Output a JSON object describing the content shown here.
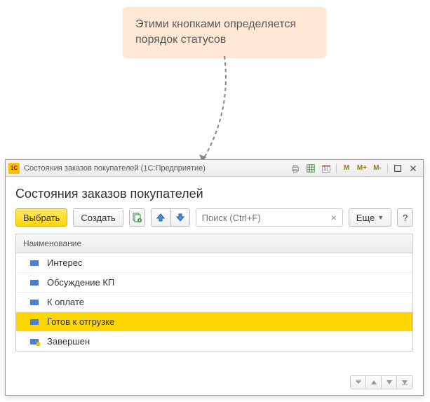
{
  "callout": {
    "text": "Этими кнопками определяется порядок статусов"
  },
  "window": {
    "title": "Состояния заказов покупателей  (1С:Предприятие)",
    "app_icon_text": "1C"
  },
  "page": {
    "title": "Состояния заказов покупателей"
  },
  "toolbar": {
    "select_label": "Выбрать",
    "create_label": "Создать",
    "search_placeholder": "Поиск (Ctrl+F)",
    "more_label": "Еще",
    "help_label": "?"
  },
  "titlebar_buttons": {
    "m": "M",
    "m_plus": "M+",
    "m_minus": "M-"
  },
  "table": {
    "header": "Наименование",
    "rows": [
      {
        "label": "Интерес",
        "final": false,
        "selected": false
      },
      {
        "label": "Обсуждение КП",
        "final": false,
        "selected": false
      },
      {
        "label": "К оплате",
        "final": false,
        "selected": false
      },
      {
        "label": "Готов к отгрузке",
        "final": false,
        "selected": true
      },
      {
        "label": "Завершен",
        "final": true,
        "selected": false
      }
    ]
  }
}
